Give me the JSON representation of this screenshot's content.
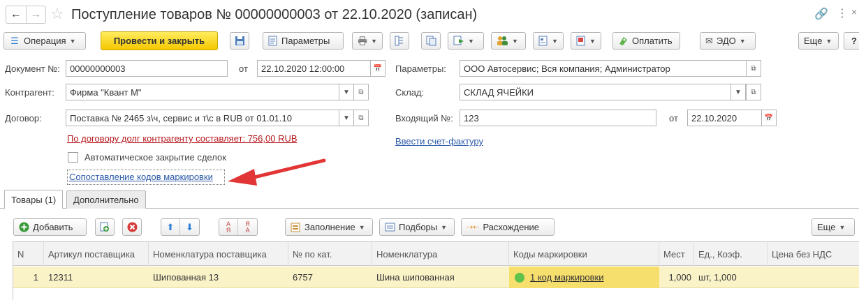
{
  "title_bar": {
    "title": "Поступление товаров № 00000000003 от 22.10.2020 (записан)",
    "back_icon": "arrow-left",
    "forward_icon": "arrow-right",
    "favorite_icon": "star",
    "link_icon": "chain-link",
    "more_icon": "vertical-dots",
    "close_icon": "close-x"
  },
  "toolbar": {
    "operation": "Операция",
    "post_and_close": "Провести и закрыть",
    "parameters": "Параметры",
    "pay": "Оплатить",
    "edo": "ЭДО",
    "more": "Еще",
    "help": "?"
  },
  "form": {
    "doc_number_label": "Документ №:",
    "doc_number": "00000000003",
    "from_label": "от",
    "doc_date": "22.10.2020 12:00:00",
    "params_label": "Параметры:",
    "params_value": "ООО Автосервис; Вся компания; Администратор",
    "counterparty_label": "Контрагент:",
    "counterparty": "Фирма \"Квант М\"",
    "warehouse_label": "Склад:",
    "warehouse": "СКЛАД ЯЧЕЙКИ",
    "contract_label": "Договор:",
    "contract": "Поставка № 2465 з\\ч, сервис и т\\с в RUB от 01.01.10",
    "incoming_label": "Входящий №:",
    "incoming_number": "123",
    "incoming_from_label": "от",
    "incoming_date": "22.10.2020",
    "debt_link": "По договору долг контрагенту составляет: 756,00 RUB",
    "invoice_link": "Ввести счет-фактуру",
    "auto_close_label": "Автоматическое закрытие сделок",
    "auto_close_checked": false,
    "marking_link": "Сопоставление кодов маркировки"
  },
  "tabs": [
    {
      "label": "Товары (1)",
      "active": true
    },
    {
      "label": "Дополнительно",
      "active": false
    }
  ],
  "table_toolbar": {
    "add": "Добавить",
    "fill": "Заполнение",
    "selections": "Подборы",
    "discrepancy": "Расхождение",
    "more": "Еще"
  },
  "table": {
    "columns": [
      "N",
      "Артикул поставщика",
      "Номенклатура поставщика",
      "№ по кат.",
      "Номенклатура",
      "Коды маркировки",
      "Мест",
      "Ед., Коэф.",
      "Цена без НДС"
    ],
    "rows": [
      {
        "n": "1",
        "supplier_article": "12311",
        "supplier_nomenclature": "Шипованная 13",
        "catalog_no": "6757",
        "nomenclature": "Шина шипованная",
        "marking_codes": "1 код маркировки",
        "places": "1,000",
        "unit_coef": "шт, 1,000",
        "price": ""
      }
    ]
  },
  "colors": {
    "accent_yellow": "#f5c800",
    "link_blue": "#2c5aa8",
    "debt_red": "#b5171c",
    "row_highlight": "#fbf3c8",
    "status_green": "#5fc24a",
    "arrow_red": "#e23535"
  }
}
